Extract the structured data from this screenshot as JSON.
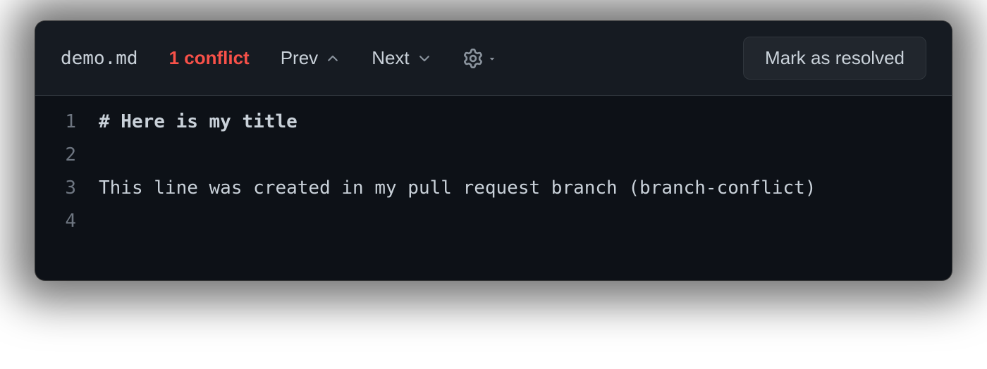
{
  "toolbar": {
    "filename": "demo.md",
    "conflict_label": "1 conflict",
    "prev_label": "Prev",
    "next_label": "Next",
    "resolve_label": "Mark as resolved"
  },
  "editor": {
    "lines": [
      {
        "num": "1",
        "text": "# Here is my title",
        "bold": true
      },
      {
        "num": "2",
        "text": "",
        "bold": false
      },
      {
        "num": "3",
        "text": "This line was created in my pull request branch (branch-conflict)",
        "bold": false
      },
      {
        "num": "4",
        "text": "",
        "bold": false
      }
    ]
  }
}
